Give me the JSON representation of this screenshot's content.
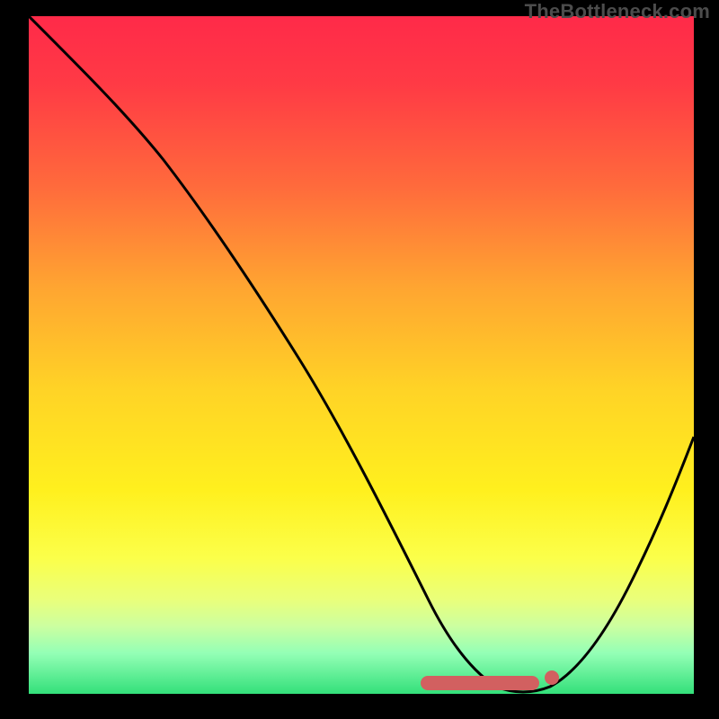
{
  "attribution": "TheBottleneck.com",
  "chart_data": {
    "type": "line",
    "title": "",
    "xlabel": "",
    "ylabel": "",
    "xlim": [
      0,
      100
    ],
    "ylim": [
      0,
      100
    ],
    "series": [
      {
        "name": "curve",
        "x": [
          0,
          5,
          10,
          15,
          20,
          25,
          30,
          35,
          40,
          45,
          50,
          55,
          58,
          60,
          63,
          66,
          69,
          72,
          75,
          78,
          82,
          86,
          90,
          94,
          97,
          100
        ],
        "values": [
          100,
          95,
          89,
          83,
          77,
          70,
          63,
          56,
          49,
          42,
          34,
          26,
          20,
          15,
          10,
          5,
          2,
          1,
          0,
          1,
          3,
          7,
          13,
          22,
          30,
          38
        ]
      }
    ],
    "markers": {
      "segment_x": [
        60,
        76
      ],
      "segment_y": 1,
      "dot": {
        "x": 78,
        "y": 2
      }
    },
    "colors": {
      "gradient_top": "#ff2a49",
      "gradient_bottom": "#33e07a",
      "curve": "#000000",
      "marker": "#d26060",
      "frame": "#000000"
    }
  }
}
